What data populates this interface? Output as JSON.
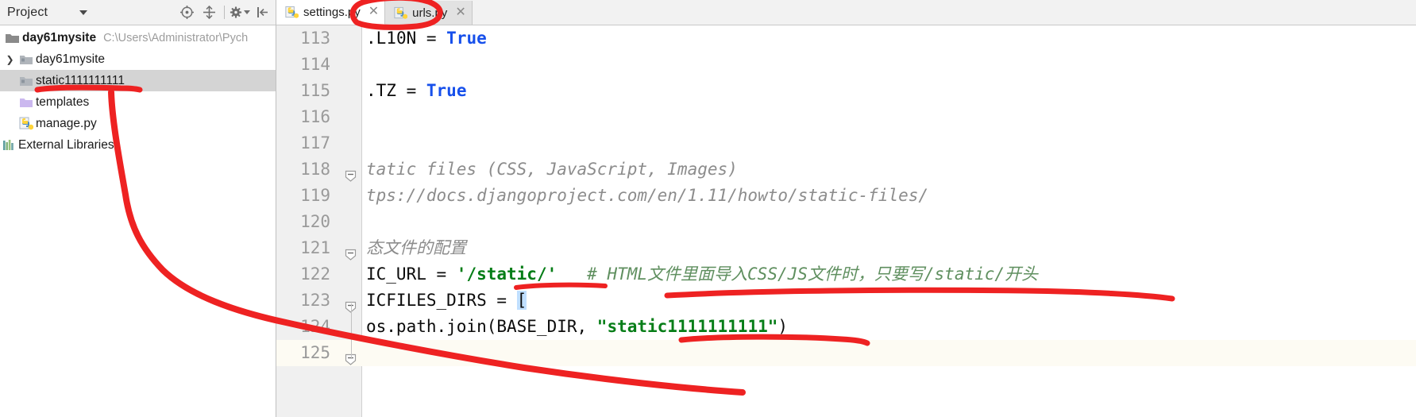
{
  "window": {
    "app": "PyCharm",
    "accent_red": "#ee2222",
    "selection_gray": "#d4d4d4",
    "gutter_bg": "#f0f0f0"
  },
  "project_panel": {
    "title": "Project",
    "toolbar_icons": [
      {
        "name": "locate-target-icon",
        "glyph": "target"
      },
      {
        "name": "collapse-all-icon",
        "glyph": "collapse"
      },
      {
        "name": "settings-gear-icon",
        "glyph": "gear"
      },
      {
        "name": "hide-panel-icon",
        "glyph": "hide"
      }
    ],
    "tree": [
      {
        "label": "day61mysite",
        "path": "C:\\Users\\Administrator\\Pych",
        "icon": "folder-root-icon",
        "depth": 0,
        "bold": true,
        "arrow": "",
        "selected": false
      },
      {
        "label": "day61mysite",
        "path": "",
        "icon": "folder-module-icon",
        "depth": 1,
        "bold": false,
        "arrow": "collapsed",
        "selected": false
      },
      {
        "label": "static1111111111",
        "path": "",
        "icon": "folder-module-icon",
        "depth": 1,
        "bold": false,
        "arrow": "",
        "selected": true
      },
      {
        "label": "templates",
        "path": "",
        "icon": "folder-templates-icon",
        "depth": 1,
        "bold": false,
        "arrow": "",
        "selected": false
      },
      {
        "label": "manage.py",
        "path": "",
        "icon": "python-file-icon",
        "depth": 1,
        "bold": false,
        "arrow": "",
        "selected": false
      },
      {
        "label": "External Libraries",
        "path": "",
        "icon": "external-libraries-icon",
        "depth": 0,
        "bold": false,
        "arrow": "",
        "selected": false
      }
    ]
  },
  "editor": {
    "tabs": [
      {
        "label": "settings.py",
        "icon": "python-file-icon",
        "active": true,
        "closable": true
      },
      {
        "label": "urls.py",
        "icon": "python-file-icon",
        "active": false,
        "closable": true
      }
    ],
    "first_line_number": 113,
    "lines": [
      {
        "number": "113",
        "fold": "",
        "highlight": false,
        "tokens": [
          {
            "t": ".",
            "c": "ident"
          },
          {
            "t": "L10N ",
            "c": "ident"
          },
          {
            "t": "= ",
            "c": "ident"
          },
          {
            "t": "True",
            "c": "const"
          }
        ]
      },
      {
        "number": "114",
        "fold": "",
        "highlight": false,
        "tokens": []
      },
      {
        "number": "115",
        "fold": "",
        "highlight": false,
        "tokens": [
          {
            "t": ".",
            "c": "ident"
          },
          {
            "t": "TZ ",
            "c": "ident"
          },
          {
            "t": "= ",
            "c": "ident"
          },
          {
            "t": "True",
            "c": "const"
          }
        ]
      },
      {
        "number": "116",
        "fold": "",
        "highlight": false,
        "tokens": []
      },
      {
        "number": "117",
        "fold": "",
        "highlight": false,
        "tokens": []
      },
      {
        "number": "118",
        "fold": "collapse",
        "highlight": false,
        "tokens": [
          {
            "t": "tatic files (CSS, JavaScript, Images)",
            "c": "cmt"
          }
        ]
      },
      {
        "number": "119",
        "fold": "",
        "highlight": false,
        "tokens": [
          {
            "t": "tps://docs.djangoproject.com/en/1.11/howto/static-files/",
            "c": "cmt"
          }
        ]
      },
      {
        "number": "120",
        "fold": "",
        "highlight": false,
        "tokens": []
      },
      {
        "number": "121",
        "fold": "collapse",
        "highlight": false,
        "tokens": [
          {
            "t": "态文件的配置",
            "c": "cmt"
          }
        ]
      },
      {
        "number": "122",
        "fold": "",
        "highlight": false,
        "tokens": [
          {
            "t": "IC_URL = ",
            "c": "ident"
          },
          {
            "t": "'/static/'",
            "c": "str"
          },
          {
            "t": "   ",
            "c": "ident"
          },
          {
            "t": "# HTML文件里面导入CSS/JS文件时，只要写/static/开头",
            "c": "cmt2"
          }
        ]
      },
      {
        "number": "123",
        "fold": "collapse",
        "highlight": false,
        "tokens": [
          {
            "t": "ICFILES_DIRS = ",
            "c": "ident"
          },
          {
            "t": "[",
            "c": "brkt-hl"
          }
        ]
      },
      {
        "number": "124",
        "fold": "",
        "highlight": false,
        "tokens": [
          {
            "t": "os.path.join(BASE_DIR, ",
            "c": "ident"
          },
          {
            "t": "\"static1111111111\"",
            "c": "str"
          },
          {
            "t": ")",
            "c": "ident"
          }
        ]
      },
      {
        "number": "125",
        "fold": "collapse",
        "highlight": true,
        "tokens": []
      }
    ]
  },
  "annotations": {
    "color": "#ee2222",
    "marks": [
      {
        "name": "circle-settings-tab",
        "shape": "ellipse"
      },
      {
        "name": "underline-static-folder",
        "shape": "line"
      },
      {
        "name": "arrow-folder-to-code",
        "shape": "curve"
      },
      {
        "name": "underline-static-url-value",
        "shape": "line"
      },
      {
        "name": "underline-html-comment",
        "shape": "line"
      },
      {
        "name": "underline-static-dirs-string",
        "shape": "line"
      }
    ]
  }
}
